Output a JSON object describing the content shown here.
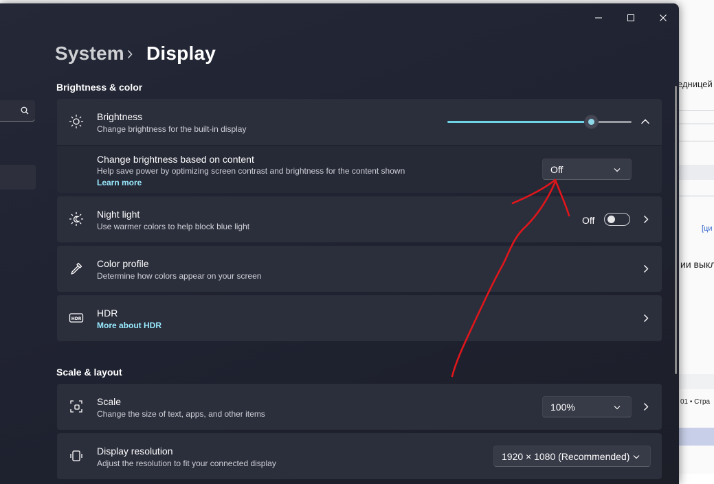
{
  "background_page": {
    "text_fragment_1": "едницей",
    "text_fragment_2": "[ци",
    "text_fragment_3": "ии выкл",
    "text_fragment_4": "01 • Стра"
  },
  "window": {
    "minimize_icon": "minimize-icon",
    "maximize_icon": "maximize-icon",
    "close_icon": "close-icon"
  },
  "breadcrumb": {
    "parent": "System",
    "separator_icon": "chevron-right-icon",
    "current": "Display"
  },
  "sections": {
    "brightness_color": "Brightness & color",
    "scale_layout": "Scale & layout"
  },
  "brightness": {
    "title": "Brightness",
    "description": "Change brightness for the built-in display",
    "value": 0.78,
    "icon": "sun-icon",
    "expanded": true
  },
  "content_brightness": {
    "title": "Change brightness based on content",
    "description": "Help save power by optimizing screen contrast and brightness for the content shown",
    "link": "Learn more",
    "dropdown_value": "Off"
  },
  "night_light": {
    "title": "Night light",
    "description": "Use warmer colors to help block blue light",
    "state_label": "Off",
    "icon": "night-light-icon"
  },
  "color_profile": {
    "title": "Color profile",
    "description": "Determine how colors appear on your screen",
    "icon": "eyedropper-icon"
  },
  "hdr": {
    "title": "HDR",
    "link": "More about HDR",
    "icon": "hdr-icon"
  },
  "scale": {
    "title": "Scale",
    "description": "Change the size of text, apps, and other items",
    "dropdown_value": "100%",
    "icon": "scale-icon"
  },
  "display_resolution": {
    "title": "Display resolution",
    "description": "Adjust the resolution to fit your connected display",
    "dropdown_value": "1920 × 1080 (Recommended)",
    "icon": "resolution-icon"
  },
  "annotation": {
    "color": "#e0161b",
    "shape": "hand-drawn-arrow"
  },
  "colors": {
    "accent": "#6fd3e6",
    "link": "#99ebff",
    "card": "#2b2e3b"
  }
}
